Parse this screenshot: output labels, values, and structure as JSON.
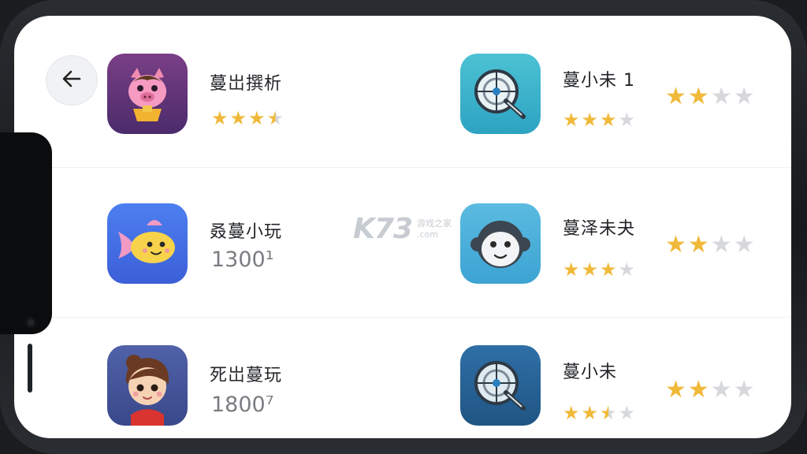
{
  "header": {
    "back_icon": "arrow-left-icon"
  },
  "apps": [
    {
      "name": "蔓岀撰析",
      "rating": 3.5,
      "count": ""
    },
    {
      "name": "蔓小未 1",
      "rating": 3,
      "count": "",
      "side_rating": 2
    },
    {
      "name": "叒蔓小玩",
      "rating": null,
      "count": "1300¹"
    },
    {
      "name": "蔓泽未夬",
      "rating": 3,
      "count": "",
      "side_rating": 2
    },
    {
      "name": "死岀蔓玩",
      "rating": null,
      "count": "1800⁷"
    },
    {
      "name": "蔓小未",
      "rating": 2.5,
      "count": "",
      "side_rating": 2
    }
  ],
  "watermark": {
    "logo": "K73",
    "line1": "游戏之家",
    "line2": ".com"
  },
  "colors": {
    "star": "#f0b93a",
    "star_empty": "#d6d8dc",
    "background": "#ffffff"
  }
}
